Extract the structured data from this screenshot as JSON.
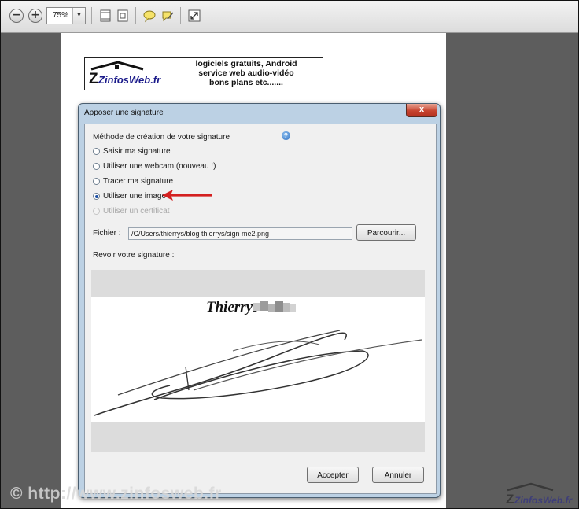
{
  "toolbar": {
    "zoom_value": "75%",
    "buttons": [
      "zoom-out-icon",
      "zoom-in-icon",
      "fit-page-icon",
      "fit-width-icon",
      "comment-icon",
      "highlight-icon",
      "fullscreen-icon"
    ]
  },
  "banner": {
    "logo_text": "ZinfosWeb.fr",
    "line1": "logiciels gratuits, Android",
    "line2": "service web audio-vidéo",
    "line3": "bons plans etc......."
  },
  "dialog": {
    "title": "Apposer une signature",
    "close_label": "x",
    "section_label": "Méthode de création de votre signature",
    "help_label": "?",
    "options": [
      {
        "label": "Saisir ma signature",
        "selected": false,
        "enabled": true
      },
      {
        "label": "Utiliser une webcam (nouveau !)",
        "selected": false,
        "enabled": true
      },
      {
        "label": "Tracer ma signature",
        "selected": false,
        "enabled": true
      },
      {
        "label": "Utiliser une image",
        "selected": true,
        "enabled": true
      },
      {
        "label": "Utiliser un certificat",
        "selected": false,
        "enabled": false
      }
    ],
    "file_label": "Fichier :",
    "file_path": "/C/Users/thierrys/blog thierrys/sign me2.png",
    "browse_label": "Parcourir...",
    "preview_label": "Revoir votre signature :",
    "signature_name": "Thierrys",
    "accept_label": "Accepter",
    "cancel_label": "Annuler"
  },
  "watermark": {
    "text": "© http://www.zinfosweb.fr",
    "logo_text": "ZinfosWeb.fr"
  },
  "colors": {
    "accent": "#1c4fa6",
    "arrow": "#d42020",
    "dialog_frame": "#bcd1e4",
    "close_button": "#c7442f"
  }
}
